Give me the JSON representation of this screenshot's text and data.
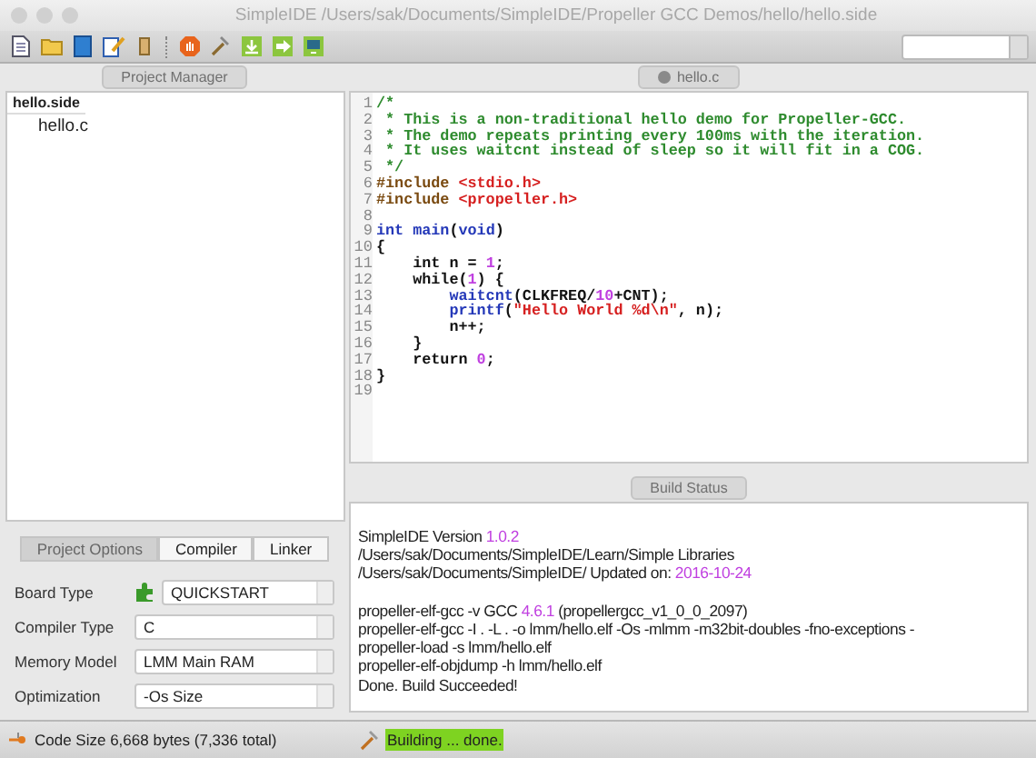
{
  "window": {
    "title": "SimpleIDE /Users/sak/Documents/SimpleIDE/Propeller GCC Demos/hello/hello.side"
  },
  "project_manager": {
    "tab": "Project Manager",
    "tree": [
      {
        "label": "hello.side",
        "selected": true,
        "children": [
          {
            "label": "hello.c",
            "selected": false
          }
        ]
      }
    ]
  },
  "editor": {
    "tab": "hello.c",
    "lines": [
      {
        "number": "1",
        "segments": [
          {
            "t": "/*",
            "kind": "comment"
          }
        ]
      },
      {
        "number": "2",
        "segments": [
          {
            "t": " * This is a non-traditional hello demo for Propeller-GCC.",
            "kind": "comment"
          }
        ]
      },
      {
        "number": "3",
        "segments": [
          {
            "t": " * The demo repeats printing every 100ms with the iteration.",
            "kind": "comment"
          }
        ]
      },
      {
        "number": "4",
        "segments": [
          {
            "t": " * It uses waitcnt instead of sleep so it will fit in a COG.",
            "kind": "comment"
          }
        ]
      },
      {
        "number": "5",
        "segments": [
          {
            "t": " */",
            "kind": "comment"
          }
        ]
      },
      {
        "number": "6",
        "segments": [
          {
            "t": "#include ",
            "kind": "preproc"
          },
          {
            "t": "<stdio.h>",
            "kind": "string"
          }
        ]
      },
      {
        "number": "7",
        "segments": [
          {
            "t": "#include ",
            "kind": "preproc"
          },
          {
            "t": "<propeller.h>",
            "kind": "string"
          }
        ]
      },
      {
        "number": "8"
      },
      {
        "number": "9",
        "segments": [
          {
            "t": "int main",
            "kind": "keyword"
          },
          {
            "t": "(",
            "kind": "plain"
          },
          {
            "t": "void",
            "kind": "keyword"
          },
          {
            "t": ")",
            "kind": "plain"
          }
        ]
      },
      {
        "number": "10",
        "segments": [
          {
            "t": "{",
            "kind": "plain"
          }
        ]
      },
      {
        "number": "11",
        "segments": [
          {
            "t": "    int n = ",
            "kind": "plain"
          },
          {
            "t": "1",
            "kind": "number"
          },
          {
            "t": ";",
            "kind": "plain"
          }
        ]
      },
      {
        "number": "12",
        "segments": [
          {
            "t": "    while(",
            "kind": "plain"
          },
          {
            "t": "1",
            "kind": "number"
          },
          {
            "t": ") {",
            "kind": "plain"
          }
        ]
      },
      {
        "number": "13",
        "segments": [
          {
            "t": "        waitcnt",
            "kind": "keyword"
          },
          {
            "t": "(CLKFREQ/",
            "kind": "plain"
          },
          {
            "t": "10",
            "kind": "number"
          },
          {
            "t": "+CNT);",
            "kind": "plain"
          }
        ]
      },
      {
        "number": "14",
        "segments": [
          {
            "t": "        printf",
            "kind": "keyword"
          },
          {
            "t": "(",
            "kind": "plain"
          },
          {
            "t": "\"Hello World %d\\n\"",
            "kind": "string"
          },
          {
            "t": ", n);",
            "kind": "plain"
          }
        ]
      },
      {
        "number": "15",
        "segments": [
          {
            "t": "        n++;",
            "kind": "plain"
          }
        ]
      },
      {
        "number": "16",
        "segments": [
          {
            "t": "    }",
            "kind": "plain"
          }
        ]
      },
      {
        "number": "17",
        "segments": [
          {
            "t": "    return ",
            "kind": "plain"
          },
          {
            "t": "0",
            "kind": "number"
          },
          {
            "t": ";",
            "kind": "plain"
          }
        ]
      },
      {
        "number": "18",
        "segments": [
          {
            "t": "}",
            "kind": "plain"
          }
        ]
      },
      {
        "number": "19"
      }
    ]
  },
  "build_status": {
    "tab": "Build Status",
    "lines": [
      {
        "segments": [
          {
            "t": "SimpleIDE Version ",
            "kind": "plain"
          },
          {
            "t": "1.0.2",
            "kind": "number"
          }
        ]
      },
      {
        "segments": [
          {
            "t": "/Users/sak/Documents/SimpleIDE/Learn/Simple Libraries",
            "kind": "plain"
          }
        ]
      },
      {
        "segments": [
          {
            "t": "/Users/sak/Documents/SimpleIDE/ Updated on: ",
            "kind": "plain"
          },
          {
            "t": "2016-10-24",
            "kind": "number"
          }
        ]
      },
      {
        "space_before": true,
        "segments": [
          {
            "t": "propeller-elf-gcc -v GCC ",
            "kind": "plain"
          },
          {
            "t": "4.6.1",
            "kind": "number"
          },
          {
            "t": " (propellergcc_v1_0_0_2097)",
            "kind": "plain"
          }
        ]
      },
      {
        "segments": [
          {
            "t": "propeller-elf-gcc -I . -L . -o lmm/hello.elf -Os -mlmm -m32bit-doubles -fno-exceptions -",
            "kind": "plain"
          }
        ]
      },
      {
        "segments": [
          {
            "t": "propeller-load -s lmm/hello.elf",
            "kind": "plain"
          }
        ]
      },
      {
        "segments": [
          {
            "t": "propeller-elf-objdump -h lmm/hello.elf",
            "kind": "plain"
          }
        ]
      },
      {
        "segments": [
          {
            "t": "Done. Build Succeeded!",
            "kind": "plain"
          }
        ]
      }
    ]
  },
  "option_tabs": [
    {
      "label": "Project Options",
      "selected": true
    },
    {
      "label": "Compiler",
      "selected": false
    },
    {
      "label": "Linker",
      "selected": false
    }
  ],
  "options": [
    {
      "label": "Board Type",
      "value": "QUICKSTART",
      "kind": "board"
    },
    {
      "label": "Compiler Type",
      "value": "C",
      "kind": "plain"
    },
    {
      "label": "Memory Model",
      "value": "LMM Main RAM",
      "kind": "plain"
    },
    {
      "label": "Optimization",
      "value": "-Os Size",
      "kind": "plain"
    }
  ],
  "status_bar": {
    "code_size": "Code Size 6,668 bytes (7,336 total)",
    "build": "Building ... done."
  }
}
